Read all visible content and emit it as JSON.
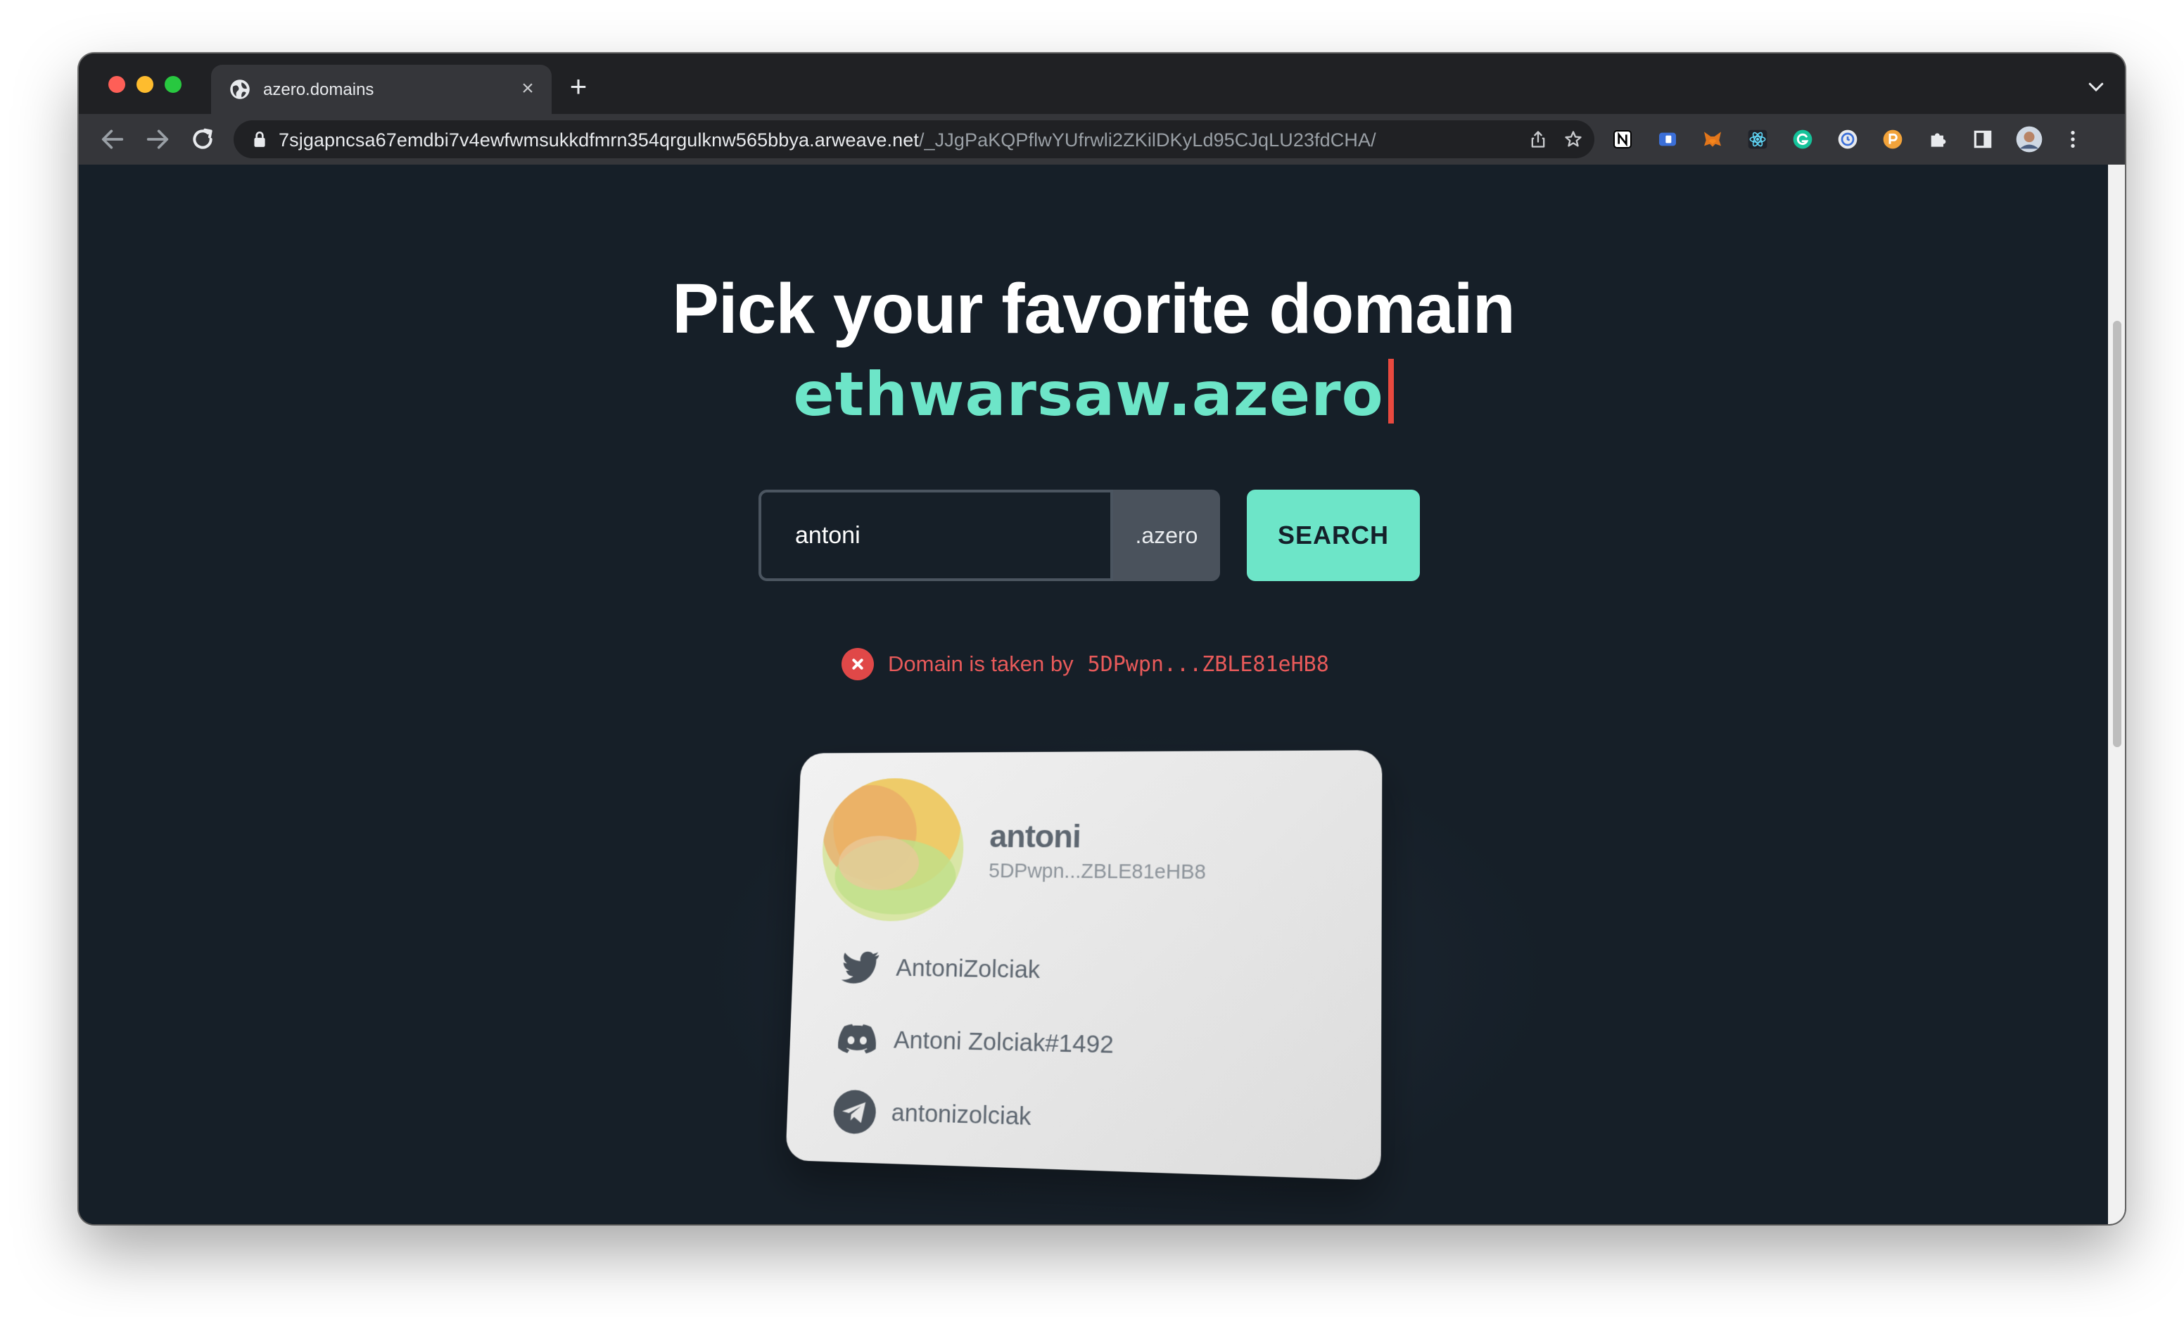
{
  "browser": {
    "tab_title": "azero.domains",
    "url_host": "7sjgapncsa67emdbi7v4ewfwmsukkdfmrn354qrgulknw565bbya.arweave.net",
    "url_path": "/_JJgPaKQPflwYUfrwli2ZKilDKyLd95CJqLU23fdCHA/"
  },
  "hero": {
    "headline": "Pick your favorite domain",
    "typed_domain": "ethwarsaw.azero"
  },
  "search": {
    "input_value": "antoni",
    "suffix": ".azero",
    "button_label": "SEARCH"
  },
  "status": {
    "message": "Domain is taken by",
    "owner_short": "5DPwpn...ZBLE81eHB8",
    "color": "#e85a5a"
  },
  "card": {
    "name": "antoni",
    "address": "5DPwpn...ZBLE81eHB8",
    "socials": [
      {
        "platform": "twitter",
        "icon": "twitter-icon",
        "handle": "AntoniZolciak"
      },
      {
        "platform": "discord",
        "icon": "discord-icon",
        "handle": "Antoni Zolciak#1492"
      },
      {
        "platform": "telegram",
        "icon": "telegram-icon",
        "handle": "antonizolciak"
      }
    ]
  },
  "colors": {
    "accent": "#6de5c8",
    "background": "#161f28",
    "error": "#e04848",
    "caret": "#e8493f"
  }
}
